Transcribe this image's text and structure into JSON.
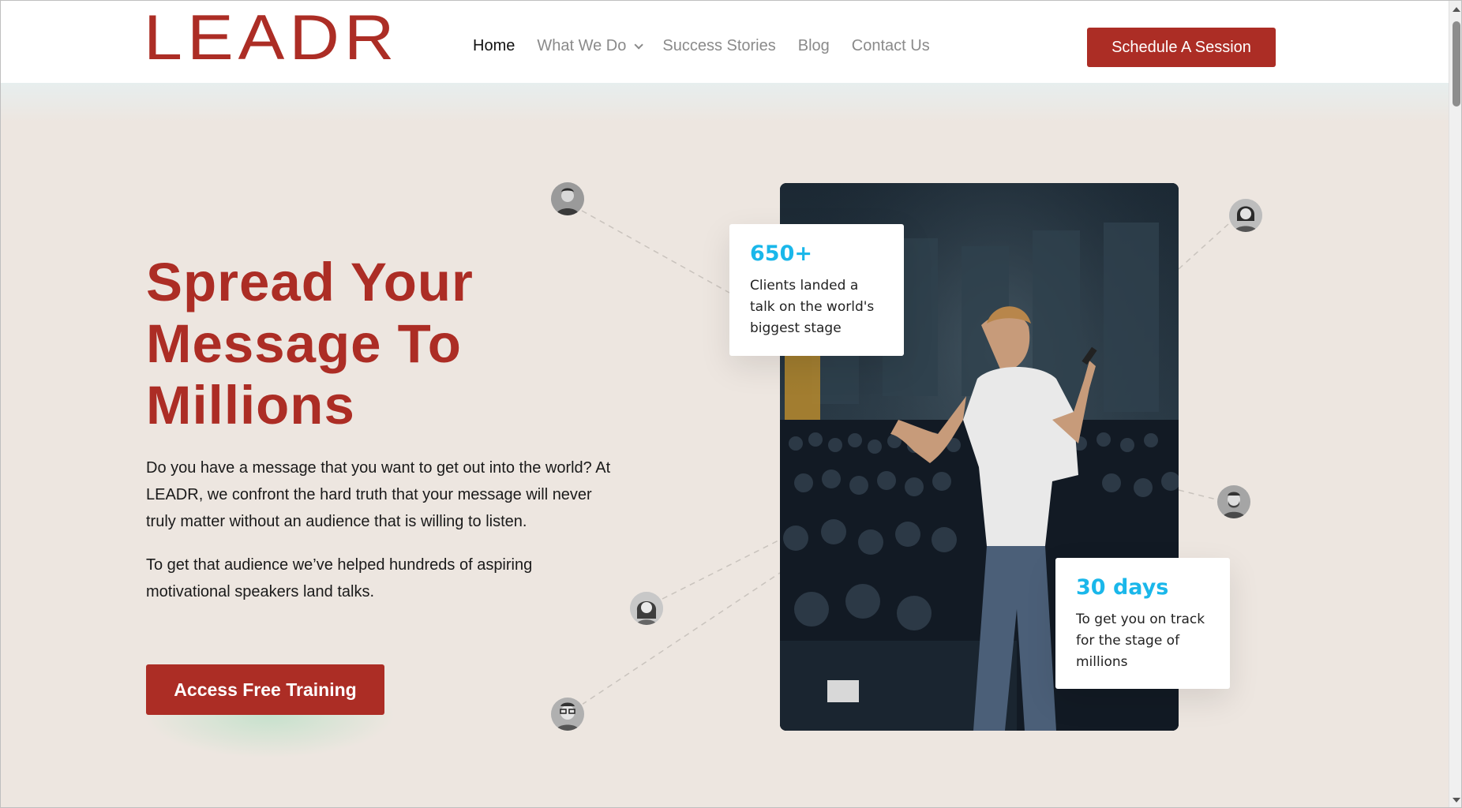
{
  "header": {
    "logo": "LEADR",
    "nav": [
      {
        "label": "Home",
        "active": true
      },
      {
        "label": "What We Do",
        "dropdown": true
      },
      {
        "label": "Success Stories"
      },
      {
        "label": "Blog"
      },
      {
        "label": "Contact Us"
      }
    ],
    "cta_label": "Schedule A Session"
  },
  "hero": {
    "title_lines": [
      "Spread Your",
      "Message To",
      "Millions"
    ],
    "paragraph1": "Do you have a message that you want to get out into the world? At LEADR, we confront the hard truth that your message will never truly matter without an audience that is willing to listen.",
    "paragraph2": "To get that audience we’ve helped hundreds of aspiring motivational speakers land talks.",
    "cta_label": "Access Free Training"
  },
  "stats": [
    {
      "value": "650+",
      "text": "Clients landed a talk on the world's biggest stage"
    },
    {
      "value": "30 days",
      "text": "To get you on track for the stage of millions"
    }
  ],
  "icons": {
    "dropdown": "chevron-down-icon",
    "avatars": [
      "avatar-man-1",
      "avatar-woman-1",
      "avatar-man-2",
      "avatar-woman-2",
      "avatar-man-glasses"
    ]
  },
  "colors": {
    "brand": "#ac2d25",
    "accent": "#1ab7ea",
    "background": "#ede6e0"
  }
}
